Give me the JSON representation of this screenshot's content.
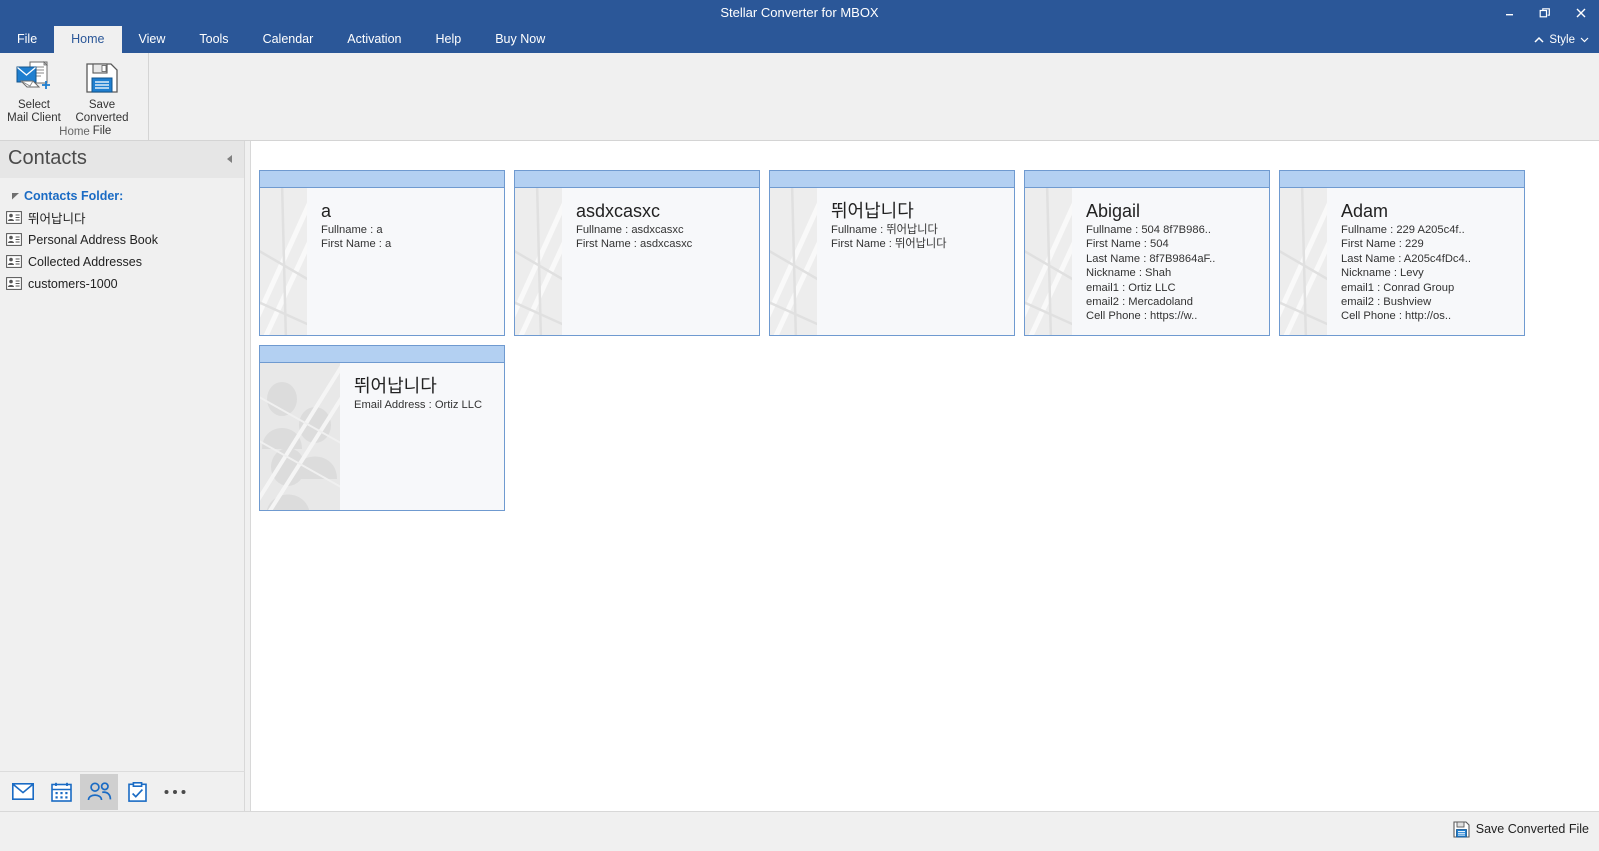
{
  "window": {
    "title": "Stellar Converter for MBOX",
    "controls": [
      {
        "name": "minimize",
        "glyph": "minimize-icon"
      },
      {
        "name": "restore",
        "glyph": "restore-icon"
      },
      {
        "name": "close",
        "glyph": "close-icon"
      }
    ]
  },
  "ribbon": {
    "tabs": [
      {
        "label": "File",
        "active": false
      },
      {
        "label": "Home",
        "active": true
      },
      {
        "label": "View",
        "active": false
      },
      {
        "label": "Tools",
        "active": false
      },
      {
        "label": "Calendar",
        "active": false
      },
      {
        "label": "Activation",
        "active": false
      },
      {
        "label": "Help",
        "active": false
      },
      {
        "label": "Buy Now",
        "active": false
      }
    ],
    "style_label": "Style",
    "group_label": "Home",
    "buttons": [
      {
        "label": "Select\nMail Client",
        "icon": "select-mail-client-icon"
      },
      {
        "label": "Save\nConverted File",
        "icon": "save-converted-file-icon"
      }
    ]
  },
  "sidebar": {
    "title": "Contacts",
    "root_label": "Contacts Folder:",
    "items": [
      {
        "label": "뛰어납니다",
        "icon": "address-book-icon"
      },
      {
        "label": "Personal Address Book",
        "icon": "address-book-icon"
      },
      {
        "label": "Collected Addresses",
        "icon": "address-book-icon"
      },
      {
        "label": "customers-1000",
        "icon": "address-book-icon"
      }
    ],
    "nav": [
      {
        "name": "mail",
        "icon": "mail-icon",
        "active": false
      },
      {
        "name": "calendar",
        "icon": "calendar-icon",
        "active": false
      },
      {
        "name": "contacts",
        "icon": "people-icon",
        "active": true
      },
      {
        "name": "tasks",
        "icon": "tasks-icon",
        "active": false
      },
      {
        "name": "more",
        "icon": "ellipsis-icon",
        "active": false
      }
    ]
  },
  "contacts": [
    {
      "name": "a",
      "photo": "lines",
      "fields": [
        "Fullname : a",
        "First Name : a"
      ]
    },
    {
      "name": "asdxcasxc",
      "photo": "lines",
      "fields": [
        "Fullname : asdxcasxc",
        "First Name : asdxcasxc"
      ]
    },
    {
      "name": "뛰어납니다",
      "photo": "lines",
      "fields": [
        "Fullname : 뛰어납니다",
        "First Name : 뛰어납니다"
      ]
    },
    {
      "name": "Abigail",
      "photo": "lines",
      "fields": [
        "Fullname : 504 8f7B986..",
        "First Name : 504",
        "Last Name : 8f7B9864aF..",
        "Nickname : Shah",
        "email1 : Ortiz LLC",
        "email2 : Mercadoland",
        "Cell Phone : https://w.."
      ]
    },
    {
      "name": "Adam",
      "photo": "lines",
      "fields": [
        "Fullname : 229 A205c4f..",
        "First Name : 229",
        "Last Name : A205c4fDc4..",
        "Nickname : Levy",
        "email1 : Conrad Group",
        "email2 : Bushview",
        "Cell Phone : http://os.."
      ]
    },
    {
      "name": "뛰어납니다",
      "photo": "people",
      "fields": [
        "Email Address : Ortiz LLC"
      ]
    }
  ],
  "statusbar": {
    "action_label": "Save Converted File",
    "action_icon": "save-icon"
  },
  "colors": {
    "titlebar": "#2b5798",
    "accent_blue": "#1a6bc4",
    "card_header": "#b3d0f2",
    "card_border": "#6f9ad0",
    "ribbon_bg": "#f0f0f0"
  }
}
